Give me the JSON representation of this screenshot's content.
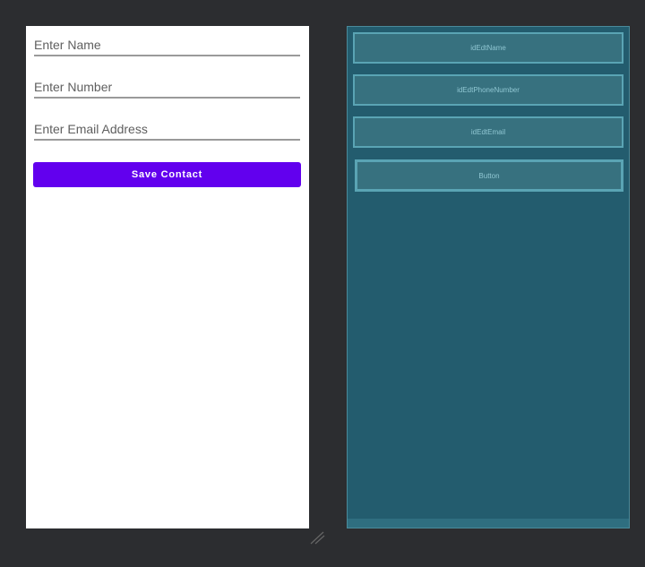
{
  "design": {
    "name_hint": "Enter Name",
    "number_hint": "Enter Number",
    "email_hint": "Enter Email Address",
    "save_label": "Save Contact"
  },
  "blueprint": {
    "name_id": "idEdtName",
    "phone_id": "idEdtPhoneNumber",
    "email_id": "idEdtEmail",
    "button_id": "Button"
  }
}
